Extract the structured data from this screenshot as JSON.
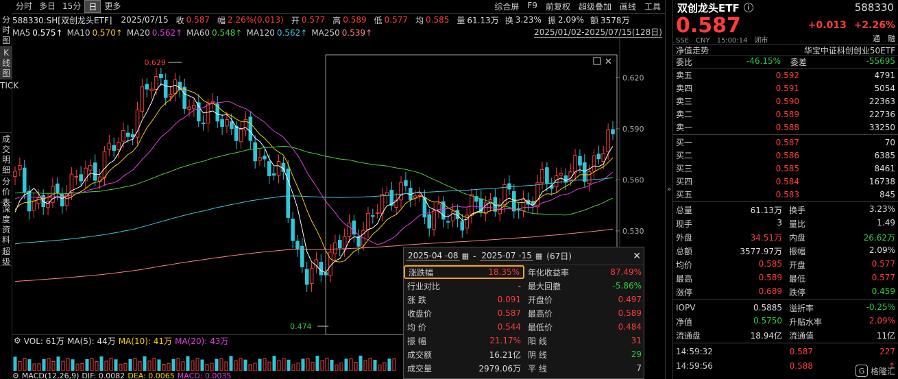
{
  "leftnav": [
    "分时图",
    "K线图",
    "TICK",
    "成交明细",
    "分价表",
    "深度资料",
    "超级"
  ],
  "topbar": {
    "periods": [
      "分时",
      "多日",
      "15分",
      "日",
      "更多"
    ],
    "active": "日",
    "tools": [
      "综合屏",
      "F9",
      "前复权",
      "超级叠加",
      "画线",
      "工具"
    ]
  },
  "quote": {
    "code_name": "588330.SH[双创龙头ETF]",
    "date": "2025/07/15",
    "close_label": "收",
    "close": "0.587",
    "amp_label": "幅",
    "amp": "2.26%(0.013)",
    "open_label": "开",
    "open": "0.577",
    "high_label": "高",
    "high": "0.589",
    "low_label": "低",
    "low": "0.577",
    "avg_label": "均",
    "avg": "0.585",
    "vol_label": "量",
    "vol": "61.13万",
    "turn_label": "换",
    "turn": "3.23%",
    "swing_label": "振",
    "swing": "2.09%",
    "amt_label": "额",
    "amt": "3578万"
  },
  "ma": [
    {
      "label": "MA5",
      "value": "0.575↑",
      "color": "#ffffff"
    },
    {
      "label": "MA10",
      "value": "0.570↑",
      "color": "#f5d000"
    },
    {
      "label": "MA20",
      "value": "0.562↑",
      "color": "#e040e0"
    },
    {
      "label": "MA60",
      "value": "0.548↑",
      "color": "#4cd137"
    },
    {
      "label": "MA120",
      "value": "0.562↑",
      "color": "#3fc7d9"
    },
    {
      "label": "MA250",
      "value": "0.539↑",
      "color": "#ff8080"
    }
  ],
  "daterange": "2025/01/02-2025/07/15(128日)",
  "chart_data": {
    "type": "candlestick",
    "y_ticks": [
      0.62,
      0.59,
      0.56,
      0.53
    ],
    "y_tick_labels": [
      "0.620",
      "0.590",
      "0.560",
      "0.530"
    ],
    "ylim": [
      0.474,
      0.629
    ],
    "high_label": "0.629",
    "low_label": "0.474",
    "anchors": [
      0.565,
      0.552,
      0.545,
      0.548,
      0.555,
      0.56,
      0.563,
      0.57,
      0.578,
      0.585,
      0.6,
      0.615,
      0.62,
      0.611,
      0.605,
      0.6,
      0.598,
      0.596,
      0.59,
      0.585,
      0.575,
      0.565,
      0.56,
      0.52,
      0.5,
      0.508,
      0.518,
      0.525,
      0.53,
      0.535,
      0.545,
      0.555,
      0.552,
      0.548,
      0.54,
      0.537,
      0.538,
      0.54,
      0.545,
      0.547,
      0.55,
      0.545,
      0.548,
      0.555,
      0.562,
      0.563,
      0.565,
      0.568,
      0.575,
      0.587
    ],
    "ma_series": [
      {
        "name": "MA5",
        "color": "#ffffff"
      },
      {
        "name": "MA10",
        "color": "#f5d000"
      },
      {
        "name": "MA20",
        "color": "#e040e0"
      },
      {
        "name": "MA60",
        "color": "#4cd137"
      },
      {
        "name": "MA120",
        "color": "#3fc7d9"
      },
      {
        "name": "MA250",
        "color": "#ff8080"
      }
    ],
    "selection": {
      "start_index": 66,
      "end_index": 127
    }
  },
  "rangebox": {
    "from": "2025-04 -08",
    "sep": "-",
    "to": "2025-07 -15",
    "days": "(67日)",
    "rows": [
      [
        "涨跌幅",
        "18.35%",
        "red",
        "年化收益率",
        "87.49%",
        "red"
      ],
      [
        "行业对比",
        "-",
        "white",
        "最大回撤",
        "-5.86%",
        "green"
      ],
      [
        "涨 跌",
        "0.091",
        "red",
        "开盘价",
        "0.497",
        "red"
      ],
      [
        "收盘价",
        "0.587",
        "red",
        "最高价",
        "0.589",
        "red"
      ],
      [
        "均 价",
        "0.544",
        "red",
        "最低价",
        "0.484",
        "red"
      ],
      [
        "振 幅",
        "21.17%",
        "red",
        "阳 线",
        "31",
        "red"
      ],
      [
        "成交额",
        "16.21亿",
        "white",
        "阴 线",
        "29",
        "green"
      ],
      [
        "成交量",
        "2979.06万",
        "white",
        "平 线",
        "7",
        "white"
      ]
    ]
  },
  "vol": {
    "label": "VOL: 61万",
    "ma5": "MA(5): 44万",
    "ma10": "MA(10): 41万",
    "ma20": "MA(20): 43万"
  },
  "macd": {
    "label": "MACD(12,26,9)",
    "dif": "DIF: 0.0082",
    "dea": "DEA: 0.0065",
    "macd": "MACD: 0.0035"
  },
  "panel": {
    "name": "双创龙头ETF",
    "info": "i",
    "code": "588330",
    "price": "0.587",
    "chg": "+0.013",
    "chg_pct": "+2.26%",
    "marks": "通　融",
    "sub": "SSE　CNY　15:00:14　闭市",
    "nav_label": "净值走势",
    "index_name": "华宝中证科创创业50ETF",
    "weibi_label": "委比",
    "weibi": "-46.15%",
    "weicha_label": "委差",
    "weicha": "-55695",
    "asks": [
      [
        "卖五",
        "0.592",
        "4791"
      ],
      [
        "卖四",
        "0.591",
        "5054"
      ],
      [
        "卖三",
        "0.590",
        "22363"
      ],
      [
        "卖二",
        "0.589",
        "22736"
      ],
      [
        "卖一",
        "0.588",
        "33250"
      ]
    ],
    "bids": [
      [
        "买一",
        "0.587",
        "70"
      ],
      [
        "买二",
        "0.586",
        "6385"
      ],
      [
        "买三",
        "0.585",
        "8461"
      ],
      [
        "买四",
        "0.584",
        "16738"
      ],
      [
        "买五",
        "0.583",
        "845"
      ]
    ],
    "stats": [
      [
        "总量",
        "61.13万",
        "white",
        "换手",
        "3.23%",
        "white"
      ],
      [
        "现手",
        "3",
        "white",
        "量比",
        "1.49",
        "white"
      ],
      [
        "外盘",
        "34.51万",
        "red",
        "内盘",
        "26.62万",
        "green"
      ],
      [
        "总额",
        "3577.97万",
        "white",
        "振幅",
        "2.09%",
        "white"
      ],
      [
        "均价",
        "0.585",
        "red",
        "开盘",
        "0.577",
        "red"
      ],
      [
        "最高",
        "0.589",
        "red",
        "最低",
        "0.577",
        "red"
      ],
      [
        "涨停",
        "0.689",
        "red",
        "跌停",
        "0.459",
        "green"
      ]
    ],
    "stats2": [
      [
        "IOPV",
        "0.5885",
        "white",
        "溢折率",
        "-0.25%",
        "green"
      ],
      [
        "净值",
        "0.5750",
        "green",
        "升贴水率",
        "2.09%",
        "red"
      ],
      [
        "流通盘",
        "18.94亿",
        "white",
        "流通值",
        "11亿",
        "white"
      ]
    ],
    "ticks": [
      [
        "14:59:32",
        "0.587",
        "227"
      ],
      [
        "14:59:56",
        "0.588",
        "↑"
      ]
    ],
    "logo": "格隆汇"
  }
}
